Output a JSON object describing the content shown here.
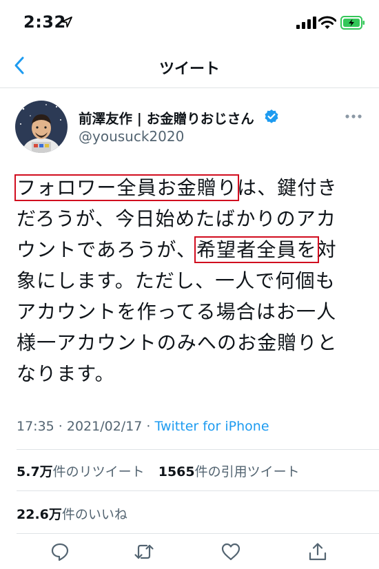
{
  "status_bar": {
    "time": "2:32",
    "icons": [
      "location-arrow-icon",
      "cellular-signal-icon",
      "wifi-icon",
      "battery-charging-icon"
    ]
  },
  "nav": {
    "title": "ツイート",
    "back_icon": "chevron-left-icon"
  },
  "tweet": {
    "display_name": "前澤友作 | お金贈りおじさん",
    "username": "@yousuck2020",
    "verified": true,
    "text_lines": [
      {
        "hl1": "フォロワー全員お金贈り",
        "rest": "は、鍵付き"
      },
      {
        "text": "だろうが、今日始めたばかりのアカ"
      },
      {
        "pre": "ウントであろうが、",
        "hl2": "希望者全員を",
        "post": "対"
      },
      {
        "text": "象にします。ただし、一人で何個も"
      },
      {
        "text": "アカウントを作ってる場合はお一人"
      },
      {
        "text": "様一アカウントのみへのお金贈りと"
      },
      {
        "text": "なります。"
      }
    ],
    "timestamp": "17:35 · 2021/02/17 · ",
    "source": "Twitter for iPhone",
    "retweets": {
      "count": "5.7万",
      "label": "件のリツイート"
    },
    "quotes": {
      "count": "1565",
      "label": "件の引用ツイート"
    },
    "likes": {
      "count": "22.6万",
      "label": "件のいいね"
    }
  },
  "colors": {
    "accent": "#1d9bf0",
    "highlight_box": "#d10c1e",
    "text": "#0f1419",
    "secondary": "#536471",
    "battery": "#34c759"
  }
}
